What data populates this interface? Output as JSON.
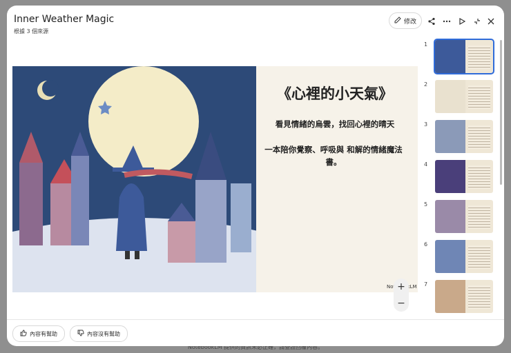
{
  "header": {
    "title": "Inner Weather Magic",
    "subtitle": "根據 3 個來源",
    "edit_label": "修改"
  },
  "slide": {
    "title": "《心裡的小天氣》",
    "subtitle": "看見情緒的烏雲，找回心裡的晴天",
    "description": "一本陪你覺察、呼吸與 和解的情緒魔法書。",
    "watermark": "NotebookLM"
  },
  "zoom": {
    "plus": "+",
    "minus": "−"
  },
  "thumbnails": [
    {
      "number": "1"
    },
    {
      "number": "2"
    },
    {
      "number": "3"
    },
    {
      "number": "4"
    },
    {
      "number": "5"
    },
    {
      "number": "6"
    },
    {
      "number": "7"
    }
  ],
  "feedback": {
    "helpful": "內容有幫助",
    "not_helpful": "內容沒有幫助"
  },
  "footer_notice": "NotebookLM 提供的資訊未必正確，請查證回覆內容。",
  "colors": {
    "accent": "#2f6bd9",
    "night_blue": "#2d4a78",
    "moon": "#f4ecc8"
  }
}
